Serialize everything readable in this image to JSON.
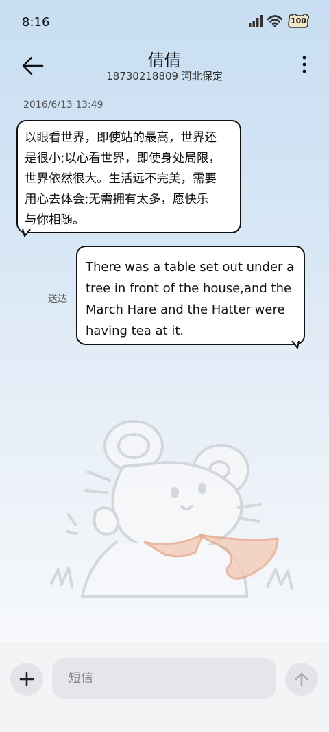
{
  "status_bar": {
    "time": "8:16",
    "battery": "100"
  },
  "header": {
    "contact_name": "倩倩",
    "contact_info": "18730218809 河北保定"
  },
  "conversation": {
    "timestamp": "2016/6/13 13:49",
    "incoming_message": {
      "lines": [
        "以眼看世界，即使站的最高，世界还",
        "是很小;以心看世界，即使身处局限，",
        "世界依然很大。生活远不完美，需要",
        "用心去体会;无需拥有太多，愿快乐",
        "与你相随。"
      ]
    },
    "outgoing_message": {
      "lines": [
        "There was a table set out under a",
        "tree in front of the house,and the",
        "March Hare and the Hatter were",
        "having tea at it."
      ],
      "status": "送达"
    }
  },
  "composer": {
    "placeholder": "短信"
  },
  "icons": {
    "back": "back-arrow-icon",
    "more": "more-vertical-icon",
    "add": "plus-icon",
    "send": "send-arrow-icon",
    "signal": "signal-icon",
    "wifi": "wifi-icon",
    "battery": "battery-icon"
  }
}
